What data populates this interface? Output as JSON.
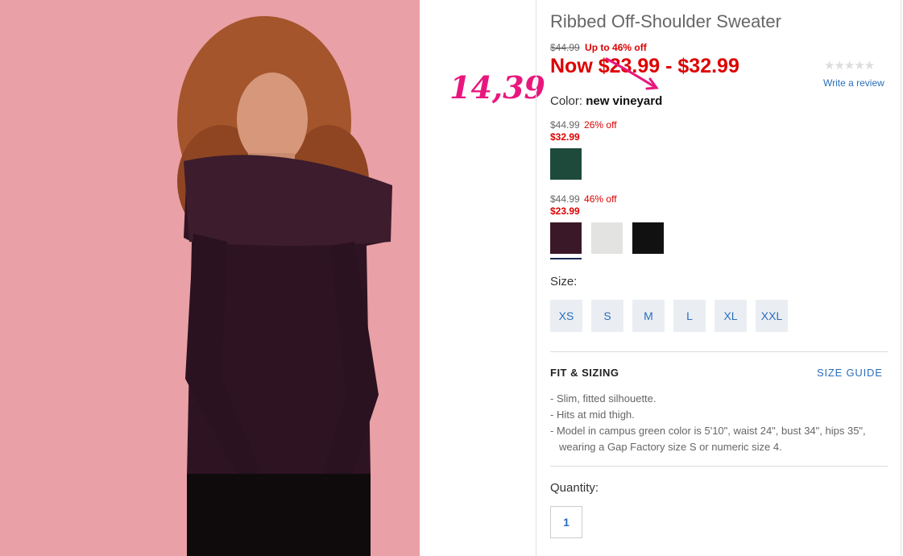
{
  "product": {
    "title": "Ribbed Off-Shoulder Sweater",
    "original_price": "$44.99",
    "discount_text": "Up to 46% off",
    "now_price": "Now $23.99 - $32.99",
    "stars": "★★★★★",
    "review_link": "Write a review",
    "color_label": "Color:",
    "color_value": "new vineyard"
  },
  "color_groups": [
    {
      "original": "$44.99",
      "discount": "26% off",
      "sale": "$32.99",
      "swatches": [
        {
          "name": "campus green",
          "color": "#1e4a3c"
        }
      ]
    },
    {
      "original": "$44.99",
      "discount": "46% off",
      "sale": "$23.99",
      "swatches": [
        {
          "name": "new vineyard",
          "color": "#3a1828",
          "selected": true
        },
        {
          "name": "light heather grey",
          "color": "#e3e3e1"
        },
        {
          "name": "black",
          "color": "#111111"
        }
      ]
    }
  ],
  "size": {
    "label": "Size:",
    "options": [
      "XS",
      "S",
      "M",
      "L",
      "XL",
      "XXL"
    ]
  },
  "fit": {
    "heading": "FIT & SIZING",
    "guide_link": "SIZE GUIDE",
    "bullets": [
      "Slim, fitted silhouette.",
      "Hits at mid thigh.",
      "Model in campus green color is 5'10\", waist 24\", bust 34\", hips 35\", wearing a Gap Factory size S or numeric size 4."
    ]
  },
  "quantity": {
    "label": "Quantity:",
    "value": "1"
  },
  "annotation": {
    "text": "14,39",
    "color": "#e8177e"
  },
  "colors": {
    "sale_red": "#dd0000",
    "link_blue": "#2a6ebb",
    "photo_bg": "#e9a0a6"
  }
}
